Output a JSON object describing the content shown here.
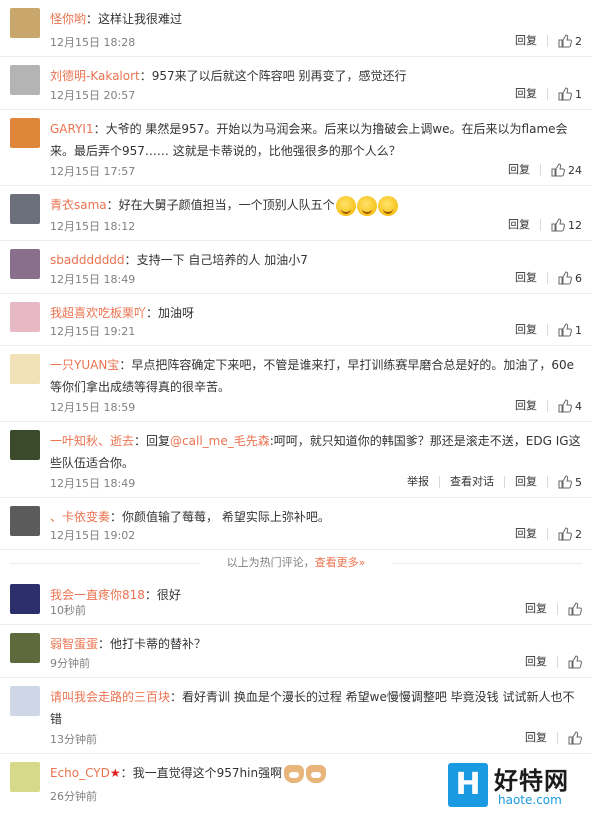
{
  "actions": {
    "reply": "回复",
    "report": "举报",
    "view_thread": "查看对话"
  },
  "hot_divider": {
    "text": "以上为热门评论，",
    "more": "查看更多»"
  },
  "hot_comments": [
    {
      "username": "怪你哟",
      "text": "这样让我很难过",
      "time": "12月15日 18:28",
      "likes": "2",
      "avatar_color": "#c9a66b"
    },
    {
      "username": "刘德明-Kakalort",
      "text": "957来了以后就这个阵容吧 别再变了，感觉还行",
      "time": "12月15日 20:57",
      "likes": "1",
      "avatar_color": "#b4b4b4"
    },
    {
      "username": "GARYI1",
      "text": "大爷的 果然是957。开始以为马润会来。后来以为撸破会上调we。在后来以为flame会来。最后弄个957…… 这就是卡蒂说的，比他强很多的那个人么？",
      "time": "12月15日 17:57",
      "likes": "24",
      "avatar_color": "#e0863a"
    },
    {
      "username": "青衣sama",
      "text": "好在大舅子颜值担当，一个顶别人队五个",
      "time": "12月15日 18:12",
      "likes": "12",
      "avatar_color": "#6b6f79"
    },
    {
      "username": "sbaddddddd",
      "text": "支持一下 自己培养的人 加油小7",
      "time": "12月15日 18:49",
      "likes": "6",
      "avatar_color": "#8a6f8c"
    },
    {
      "username": "我超喜欢吃板栗吖",
      "text": "加油呀",
      "time": "12月15日 19:21",
      "likes": "1",
      "avatar_color": "#e6b9c5"
    },
    {
      "username": "一只YUAN宝",
      "text": "早点把阵容确定下来吧，不管是谁来打，早打训练赛早磨合总是好的。加油了，60e等你们拿出成绩等得真的很辛苦。",
      "time": "12月15日 18:59",
      "likes": "4",
      "avatar_color": "#f0e2b6"
    },
    {
      "username": "一叶知秋、逝去",
      "reply_prefix": "回复",
      "reply_target": "@call_me_毛先森",
      "text": ":呵呵，就只知道你的韩国爹？那还是滚走不送，EDG IG这些队伍适合你。",
      "time": "12月15日 18:49",
      "likes": "5",
      "avatar_color": "#3b4a2a"
    },
    {
      "username": "、卡依变奏",
      "text": "你颜值输了莓莓， 希望实际上弥补吧。",
      "time": "12月15日 19:02",
      "likes": "2",
      "avatar_color": "#5b5b5b"
    }
  ],
  "recent_comments": [
    {
      "username": "我会一直疼你818",
      "text": "很好",
      "time": "10秒前",
      "avatar_color": "#2b2f6b"
    },
    {
      "username": "弱智蛋蛋",
      "text": "他打卡蒂的替补？",
      "time": "9分钟前",
      "avatar_color": "#5f6a3c"
    },
    {
      "username": "请叫我会走路的三百块",
      "text": "看好青训 换血是个漫长的过程 希望we慢慢调整吧 毕竟没钱 试试新人也不错",
      "time": "13分钟前",
      "avatar_color": "#cfd7e6"
    },
    {
      "username": "Echo_CYD",
      "text": "我一直觉得这个957hin强啊",
      "time": "26分钟前",
      "avatar_color": "#d7d98a"
    }
  ],
  "watermark": {
    "logo": "H",
    "title": "好特网",
    "url": "haote.com"
  },
  "colors": {
    "username": "#eb7350",
    "link": "#3c6e9c",
    "meta": "#808080",
    "border": "#ececec"
  }
}
